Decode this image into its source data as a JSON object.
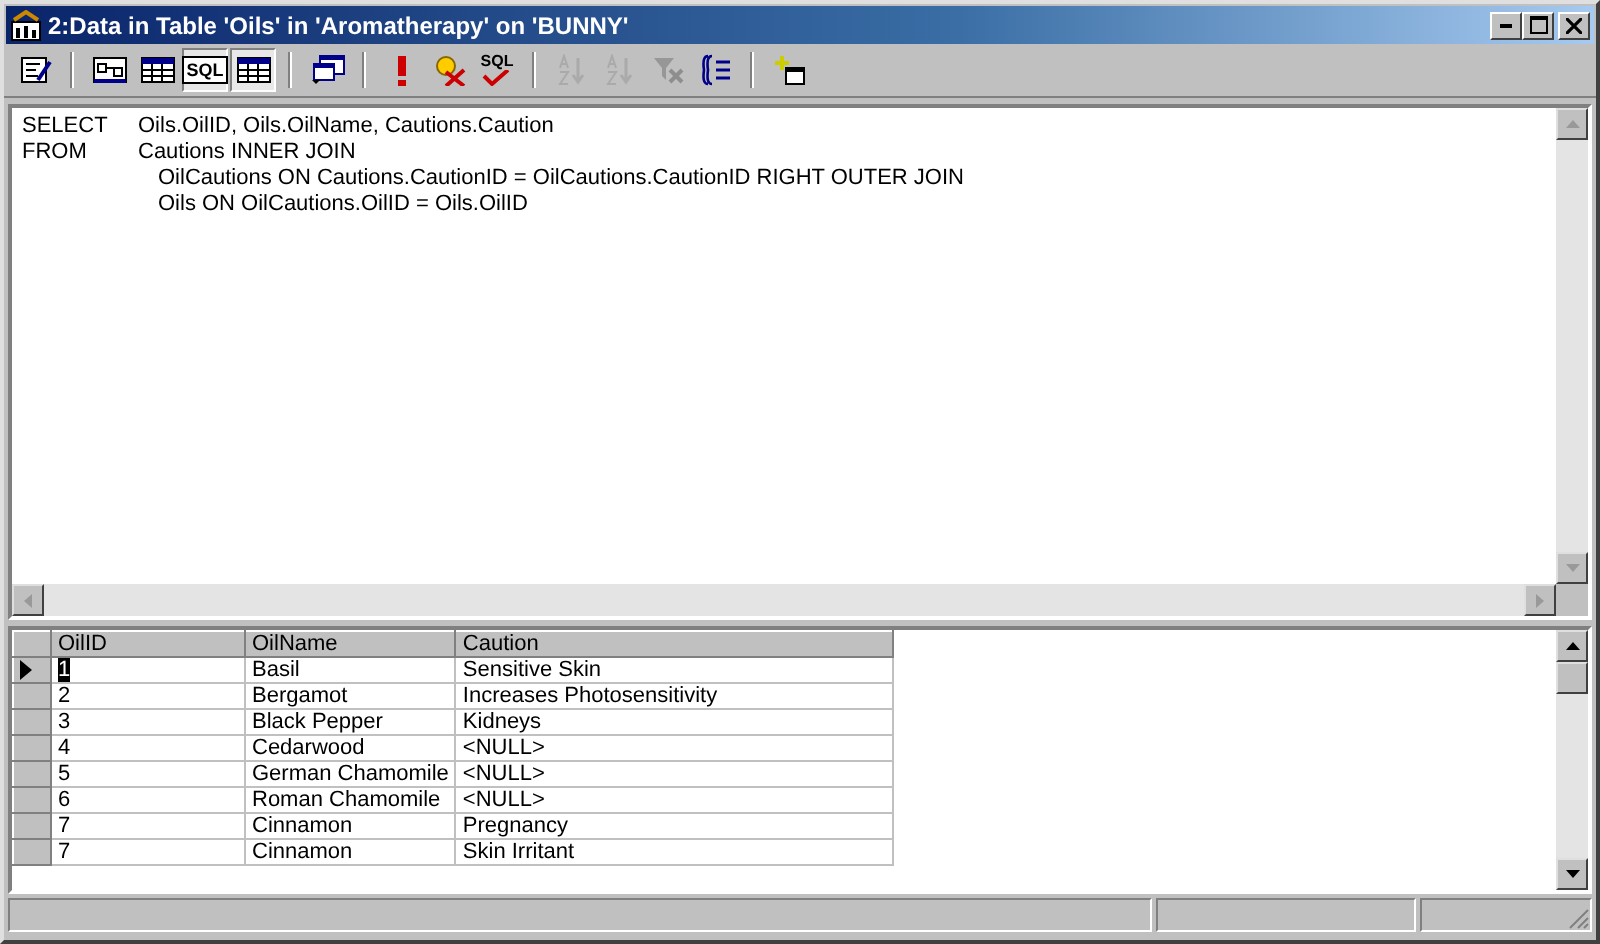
{
  "window": {
    "title": "2:Data in Table 'Oils' in 'Aromatherapy' on 'BUNNY'"
  },
  "toolbar": [
    {
      "kind": "properties",
      "selected": false,
      "disabled": false
    },
    {
      "kind": "separator"
    },
    {
      "kind": "diagram",
      "selected": false,
      "disabled": false
    },
    {
      "kind": "grid",
      "selected": false,
      "disabled": false
    },
    {
      "kind": "sql",
      "label": "SQL",
      "selected": true,
      "disabled": false
    },
    {
      "kind": "results",
      "selected": true,
      "disabled": false
    },
    {
      "kind": "separator"
    },
    {
      "kind": "query-type",
      "selected": false,
      "disabled": false
    },
    {
      "kind": "separator"
    },
    {
      "kind": "run",
      "selected": false,
      "disabled": false
    },
    {
      "kind": "clear",
      "selected": false,
      "disabled": false
    },
    {
      "kind": "verify",
      "label": "SQL",
      "selected": false,
      "disabled": false
    },
    {
      "kind": "separator"
    },
    {
      "kind": "sort-asc",
      "selected": false,
      "disabled": true
    },
    {
      "kind": "sort-desc",
      "selected": false,
      "disabled": true
    },
    {
      "kind": "remove-filter",
      "selected": false,
      "disabled": true
    },
    {
      "kind": "group-by",
      "selected": false,
      "disabled": false
    },
    {
      "kind": "separator"
    },
    {
      "kind": "add-table",
      "selected": false,
      "disabled": false
    }
  ],
  "sql": [
    {
      "keyword": "SELECT",
      "text": "Oils.OilID, Oils.OilName, Cautions.Caution"
    },
    {
      "keyword": "FROM",
      "text": "Cautions INNER JOIN"
    },
    {
      "text": "OilCautions ON Cautions.CautionID = OilCautions.CautionID RIGHT OUTER JOIN"
    },
    {
      "text": "Oils ON OilCautions.OilID = Oils.OilID"
    }
  ],
  "table": {
    "columns": [
      "OilID",
      "OilName",
      "Caution"
    ],
    "rows": [
      {
        "cells": [
          "1",
          "Basil",
          "Sensitive Skin"
        ],
        "selected": true
      },
      {
        "cells": [
          "2",
          "Bergamot",
          "Increases Photosensitivity"
        ],
        "selected": false
      },
      {
        "cells": [
          "3",
          "Black Pepper",
          "Kidneys"
        ],
        "selected": false
      },
      {
        "cells": [
          "4",
          "Cedarwood",
          "<NULL>"
        ],
        "selected": false
      },
      {
        "cells": [
          "5",
          "German Chamomile",
          "<NULL>"
        ],
        "selected": false
      },
      {
        "cells": [
          "6",
          "Roman Chamomile",
          "<NULL>"
        ],
        "selected": false
      },
      {
        "cells": [
          "7",
          "Cinnamon",
          "Pregnancy"
        ],
        "selected": false
      },
      {
        "cells": [
          "7",
          "Cinnamon",
          "Skin Irritant"
        ],
        "selected": false
      }
    ]
  }
}
